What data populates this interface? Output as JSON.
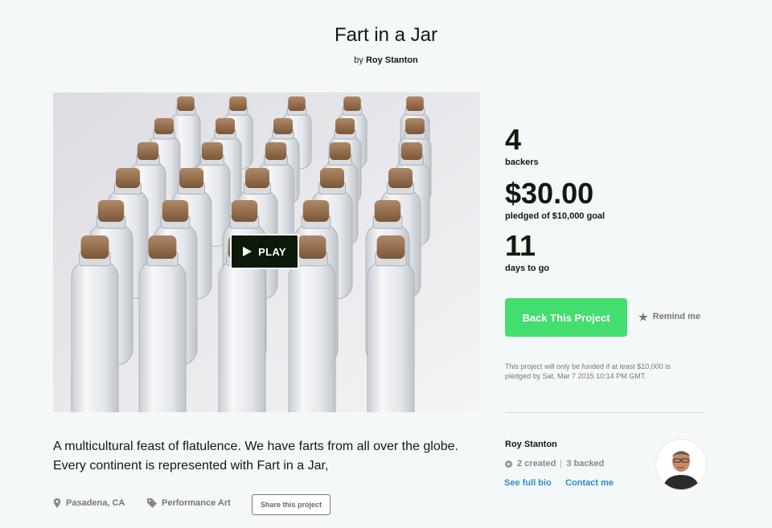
{
  "project": {
    "title": "Fart in a Jar",
    "by_prefix": "by",
    "creator": "Roy Stanton"
  },
  "video": {
    "play_label": "PLAY"
  },
  "stats": {
    "backers_count": "4",
    "backers_label": "backers",
    "pledged_amount": "$30.00",
    "pledged_label": "pledged of $10,000 goal",
    "days_count": "11",
    "days_label": "days to go"
  },
  "actions": {
    "back_label": "Back This Project",
    "remind_label": "Remind me"
  },
  "funding_note": "This project will only be funded if at least $10,000 is pledged by Sat, Mar 7 2015 10:14 PM GMT.",
  "blurb": "A multicultural feast of flatulence. We have farts from all over the globe. Every continent is represented with Fart in a Jar,",
  "meta": {
    "location": "Pasadena, CA",
    "category": "Performance Art",
    "share_label": "Share this project"
  },
  "creator_card": {
    "name": "Roy Stanton",
    "created": "2 created",
    "backed": "3 backed",
    "bio_link": "See full bio",
    "contact_link": "Contact me"
  },
  "colors": {
    "accent_green": "#44dd6f",
    "link_blue": "#2a8bd4",
    "text_dark": "#0f1b0c",
    "muted": "#777777",
    "background": "#f5f8f9"
  },
  "icons": [
    "play-icon",
    "star-icon",
    "location-pin-icon",
    "tag-icon",
    "creator-icon"
  ]
}
